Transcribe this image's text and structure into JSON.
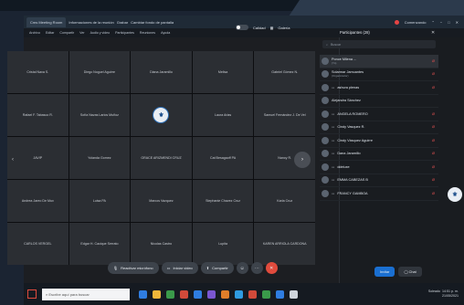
{
  "window": {
    "tabs": [
      "Cms Meeting Room",
      "Informaciones de la reunión",
      "Grabar",
      "Cambiar fondo de pantalla"
    ],
    "recording_label": "Comenzando",
    "title_controls": [
      "⌃",
      "−",
      "□",
      "✕"
    ]
  },
  "menu": [
    "Archivo",
    "Editar",
    "Compartir",
    "Ver",
    "Audio y video",
    "Participantes",
    "Reuniones",
    "Ayuda"
  ],
  "stage_controls": {
    "toggle_label": "Calidad",
    "view_label": "Galería"
  },
  "tiles": [
    [
      "Cristal Nava S.",
      "Diego Noguel Aguirre",
      "Diana Jaramillo",
      "Melisa",
      "Gabriel Gómez N."
    ],
    [
      "Rafael F. Tabasco R.",
      "Sofía Navas Larios Muñoz",
      "",
      "Laura Arias",
      "Samuel Fernández J. De Vel"
    ],
    [
      "JAVIP",
      "Yolanda Gomez",
      "GRACE ARIZMENDI CRUZ",
      "Cat Besagaoff PA",
      "Nancy R."
    ],
    [
      "Andrea Jareo De Mux",
      "Luisa PA",
      "Marcos Vazquez",
      "Stephanie Chavez Cruz",
      "Karla Cruz"
    ],
    [
      "CARLOS VERGEL",
      "Edgar H. Cacique Serrato",
      "Nicolas Castro",
      "Lupita",
      "KAREN ARRIOLA CARDONA"
    ]
  ],
  "toolbar": {
    "mute": "Reactivar micrófono",
    "video": "Iniciar video",
    "share": "Compartir"
  },
  "participants": {
    "title": "Participantes (28)",
    "search_placeholder": "Buscar",
    "rows": [
      {
        "name": "Ponce Milena ...",
        "sub": "(Yo)"
      },
      {
        "name": "Solarmar Jamuantes",
        "sub": "(Organizador)"
      },
      {
        "name": "ashura plenas",
        "sub": ""
      },
      {
        "name": "Alejandra Sánchez",
        "sub": ""
      },
      {
        "name": "ANGELA ROMERO",
        "sub": ""
      },
      {
        "name": "Cindy Vasquez R.",
        "sub": ""
      },
      {
        "name": "Cindy Vásquez Aguirre",
        "sub": ""
      },
      {
        "name": "Dana Jaramillo",
        "sub": ""
      },
      {
        "name": "ddeluxe",
        "sub": ""
      },
      {
        "name": "EMMA CABEZAS B",
        "sub": ""
      },
      {
        "name": "FRANCY GAMBOA",
        "sub": ""
      }
    ],
    "invite": "Invitar",
    "chat": "Chat"
  },
  "taskbar": {
    "search_text": "Escribe aquí para buscar",
    "time": "14:51 p. m.",
    "date": "21/05/2021",
    "tray_label": "Soleado",
    "icon_colors": [
      "#2f7de1",
      "#f0b73a",
      "#3a9a4a",
      "#d14a3a",
      "#2f7de1",
      "#7a56d0",
      "#e07e2a",
      "#2f9be1",
      "#d14a3a",
      "#3a9a4a",
      "#2f7de1",
      "#cfd5dc"
    ]
  }
}
